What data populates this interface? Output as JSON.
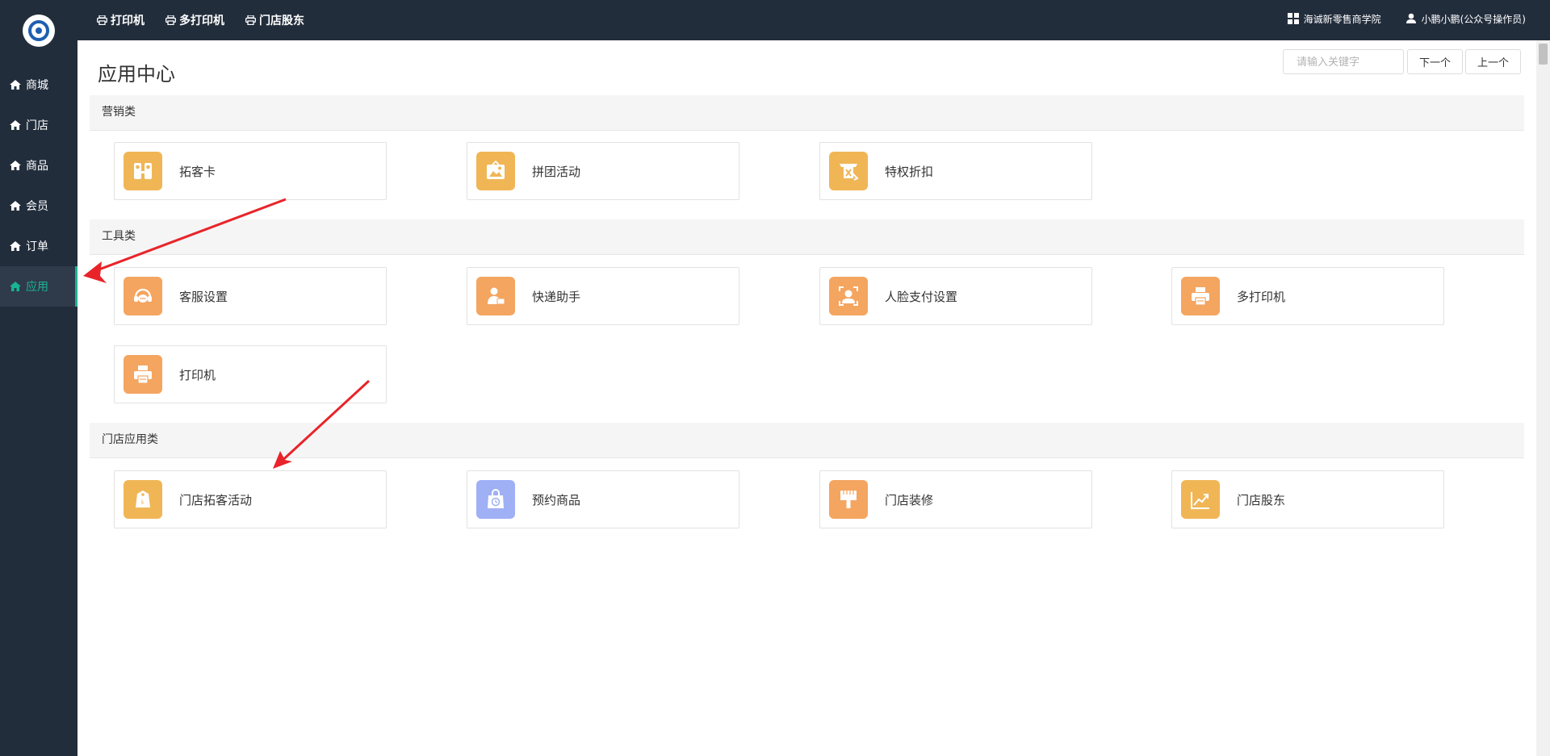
{
  "sidebar": {
    "items": [
      {
        "label": "商城",
        "icon": "home-icon"
      },
      {
        "label": "门店",
        "icon": "home-icon"
      },
      {
        "label": "商品",
        "icon": "home-icon"
      },
      {
        "label": "会员",
        "icon": "home-icon"
      },
      {
        "label": "订单",
        "icon": "home-icon"
      },
      {
        "label": "应用",
        "icon": "home-icon",
        "active": true
      }
    ]
  },
  "topbar": {
    "links": [
      {
        "label": "打印机",
        "icon": "printer-icon"
      },
      {
        "label": "多打印机",
        "icon": "printer-icon"
      },
      {
        "label": "门店股东",
        "icon": "printer-icon"
      }
    ],
    "store_name": "海诚新零售商学院",
    "user_name": "小鹏小鹏(公众号操作员)"
  },
  "page": {
    "title": "应用中心",
    "search_placeholder": "请输入关键字",
    "next_label": "下一个",
    "prev_label": "上一个"
  },
  "sections": [
    {
      "title": "营销类",
      "apps": [
        {
          "label": "拓客卡",
          "icon": "people-card-icon",
          "color": "#f0b656"
        },
        {
          "label": "拼团活动",
          "icon": "group-photo-icon",
          "color": "#f0b656"
        },
        {
          "label": "特权折扣",
          "icon": "discount-icon",
          "color": "#f0b656"
        }
      ]
    },
    {
      "title": "工具类",
      "apps": [
        {
          "label": "客服设置",
          "icon": "customer-service-icon",
          "color": "#f4a560"
        },
        {
          "label": "快递助手",
          "icon": "courier-icon",
          "color": "#f4a560"
        },
        {
          "label": "人脸支付设置",
          "icon": "face-pay-icon",
          "color": "#f4a560"
        },
        {
          "label": "多打印机",
          "icon": "printer-icon",
          "color": "#f4a560"
        },
        {
          "label": "打印机",
          "icon": "printer-icon",
          "color": "#f4a560"
        }
      ]
    },
    {
      "title": "门店应用类",
      "apps": [
        {
          "label": "门店拓客活动",
          "icon": "tag-icon",
          "color": "#f0b656"
        },
        {
          "label": "预约商品",
          "icon": "bag-clock-icon",
          "color": "#9fb0f5"
        },
        {
          "label": "门店装修",
          "icon": "brush-icon",
          "color": "#f4a560"
        },
        {
          "label": "门店股东",
          "icon": "chart-up-icon",
          "color": "#f0b656"
        }
      ]
    }
  ]
}
